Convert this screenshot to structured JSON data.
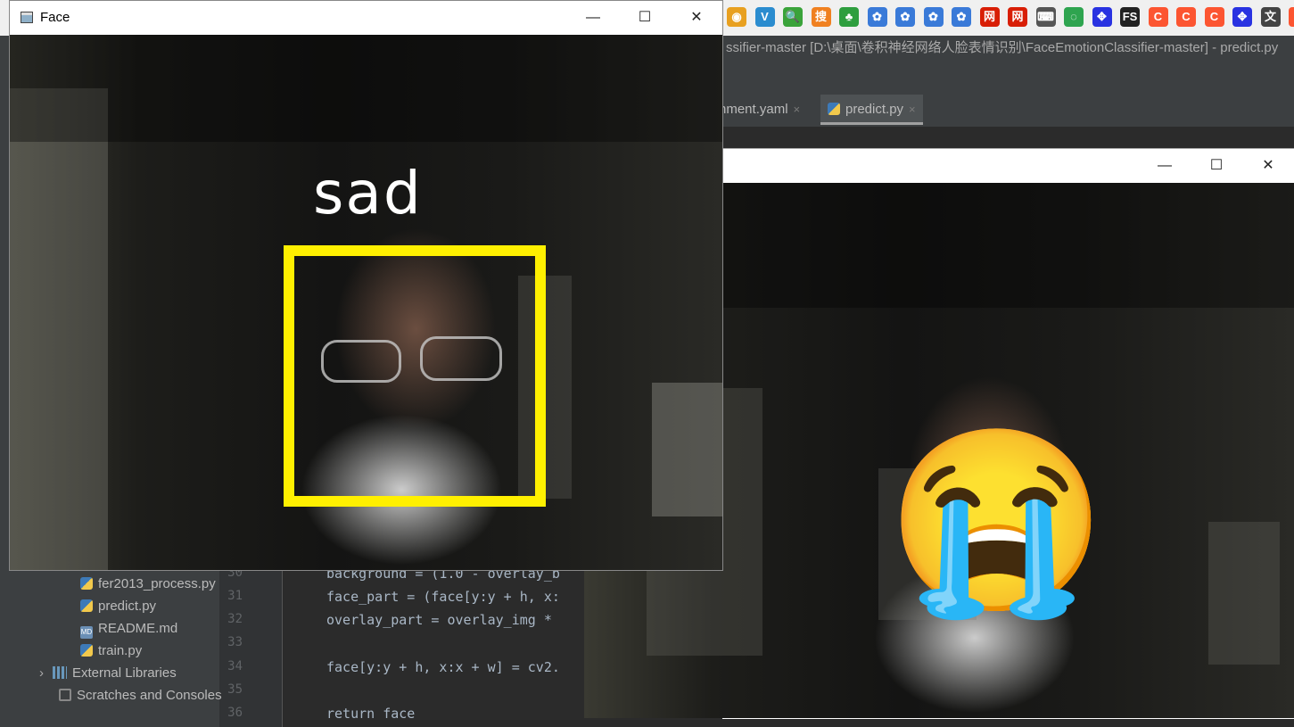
{
  "taskbar": {
    "icons": [
      {
        "name": "weibo-icon",
        "color": "#e8a020",
        "glyph": "◉"
      },
      {
        "name": "v-browser-icon",
        "color": "#2b8ccf",
        "glyph": "V"
      },
      {
        "name": "search-tool-icon",
        "color": "#3aa33a",
        "glyph": "🔍"
      },
      {
        "name": "sogou-icon",
        "color": "#f08020",
        "glyph": "搜"
      },
      {
        "name": "leaf-icon",
        "color": "#2e9e3e",
        "glyph": "♣"
      },
      {
        "name": "baidu-cloud-icon-1",
        "color": "#3a7ad8",
        "glyph": "✿"
      },
      {
        "name": "baidu-cloud-icon-2",
        "color": "#3a7ad8",
        "glyph": "✿"
      },
      {
        "name": "baidu-cloud-icon-3",
        "color": "#3a7ad8",
        "glyph": "✿"
      },
      {
        "name": "baidu-cloud-icon-4",
        "color": "#3a7ad8",
        "glyph": "✿"
      },
      {
        "name": "china-net-icon-1",
        "color": "#d81e06",
        "glyph": "网"
      },
      {
        "name": "china-net-icon-2",
        "color": "#d81e06",
        "glyph": "网"
      },
      {
        "name": "terminal-icon",
        "color": "#555555",
        "glyph": "⌨"
      },
      {
        "name": "refresh-icon",
        "color": "#2ea44f",
        "glyph": "◌"
      },
      {
        "name": "baidu-paw-icon-1",
        "color": "#2932e1",
        "glyph": "✥"
      },
      {
        "name": "fs-icon",
        "color": "#222222",
        "glyph": "FS"
      },
      {
        "name": "csdn-icon-1",
        "color": "#fc5531",
        "glyph": "C"
      },
      {
        "name": "csdn-icon-2",
        "color": "#fc5531",
        "glyph": "C"
      },
      {
        "name": "csdn-icon-3",
        "color": "#fc5531",
        "glyph": "C"
      },
      {
        "name": "baidu-paw-icon-2",
        "color": "#2932e1",
        "glyph": "✥"
      },
      {
        "name": "translate-icon",
        "color": "#444444",
        "glyph": "文"
      },
      {
        "name": "csdn-icon-4",
        "color": "#fc5531",
        "glyph": "C"
      }
    ]
  },
  "ide": {
    "title": "ssifier-master [D:\\桌面\\卷积神经网络人脸表情识别\\FaceEmotionClassifier-master] - predict.py",
    "tabs": [
      {
        "label": "nment.yaml",
        "close": "×"
      },
      {
        "label": "predict.py",
        "close": "×"
      }
    ],
    "tree": [
      {
        "label": "fer2013_process.py",
        "icon": "py"
      },
      {
        "label": "predict.py",
        "icon": "py"
      },
      {
        "label": "README.md",
        "icon": "md"
      },
      {
        "label": "train.py",
        "icon": "py"
      },
      {
        "label": "External Libraries",
        "icon": "lib"
      },
      {
        "label": "Scratches and Consoles",
        "icon": "scratch"
      }
    ],
    "line_numbers": [
      "30",
      "31",
      "32",
      "33",
      "34",
      "35",
      "36"
    ],
    "code_lines": [
      "background = (1.0 - overlay_b",
      "face_part = (face[y:y + h, x:",
      "overlay_part = overlay_img *",
      "",
      "face[y:y + h, x:x + w] = cv2.",
      "",
      "return face"
    ],
    "md_badge": "MD"
  },
  "face_window": {
    "title": "Face",
    "minimize": "—",
    "maximize": "☐",
    "close": "✕",
    "emotion_label": "sad",
    "box_color": "#fff000"
  },
  "emoji_window": {
    "minimize": "—",
    "maximize": "☐",
    "close": "✕",
    "emoji": "😭"
  }
}
